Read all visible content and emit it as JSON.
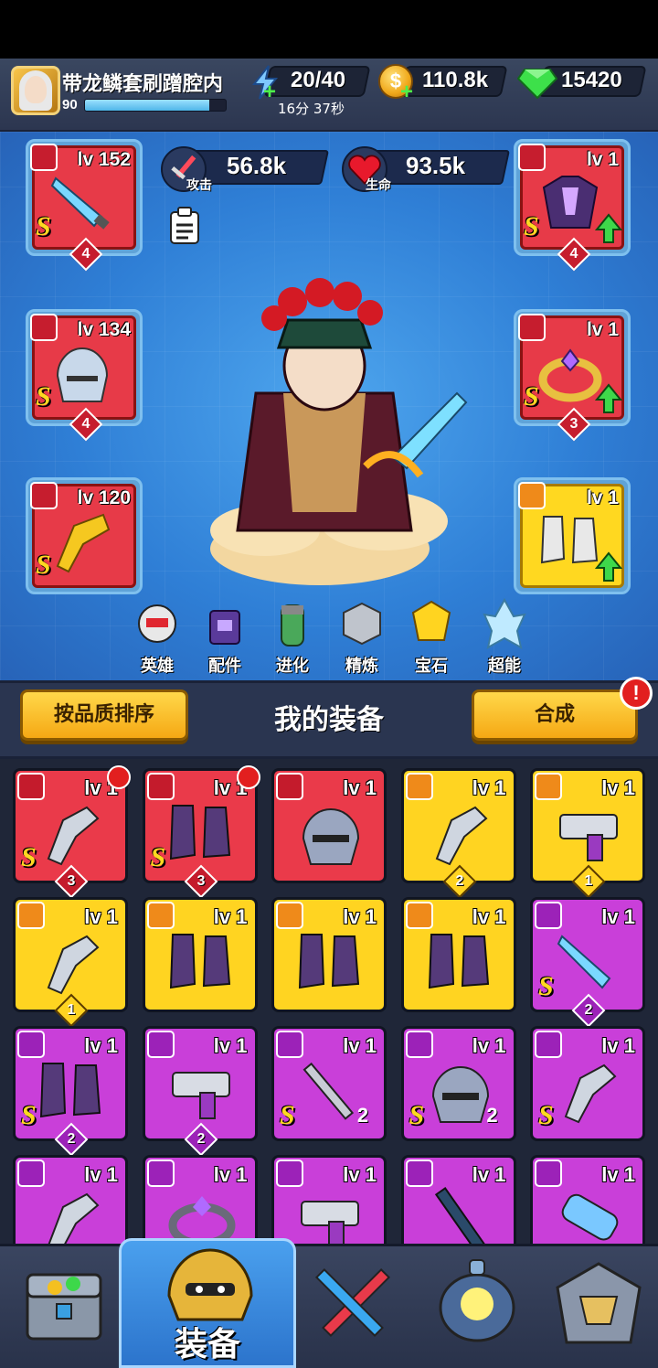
{
  "player": {
    "name": "带龙鳞套刷蹭腔内",
    "level": "90",
    "xp_fraction": 0.88
  },
  "resources": {
    "energy": "20/40",
    "energy_timer": "16分 37秒",
    "coins": "110.8k",
    "gems": "15420"
  },
  "stats": {
    "attack_value": "56.8k",
    "attack_label": "攻击",
    "hp_value": "93.5k",
    "hp_label": "生命"
  },
  "equipped": {
    "weapon": {
      "level": "lv 152",
      "grade": "S",
      "stars": "4"
    },
    "helmet": {
      "level": "lv 134",
      "grade": "S",
      "stars": "4"
    },
    "gloves": {
      "level": "lv 120",
      "grade": "S"
    },
    "armor": {
      "level": "lv 1",
      "grade": "S",
      "stars": "4"
    },
    "ring": {
      "level": "lv 1",
      "grade": "S",
      "stars": "3"
    },
    "boots": {
      "level": "lv 1"
    }
  },
  "hero_menu": [
    {
      "label": "英雄",
      "icon": "hero-icon"
    },
    {
      "label": "配件",
      "icon": "accessory-icon"
    },
    {
      "label": "进化",
      "icon": "evolve-icon"
    },
    {
      "label": "精炼",
      "icon": "refine-icon"
    },
    {
      "label": "宝石",
      "icon": "gem-icon"
    },
    {
      "label": "超能",
      "icon": "superpower-icon"
    }
  ],
  "inventory": {
    "sort_button": "按品质排序",
    "title": "我的装备",
    "merge_button": "合成",
    "alert": "!",
    "items": [
      {
        "level": "lv 1",
        "rarity": "red",
        "grade": "S",
        "count": "3",
        "icon": "gauntlet-icon",
        "new": true
      },
      {
        "level": "lv 1",
        "rarity": "red",
        "grade": "S",
        "count": "3",
        "icon": "boots-icon",
        "new": true
      },
      {
        "level": "lv 1",
        "rarity": "red",
        "grade": "",
        "count": "",
        "icon": "helmet-icon",
        "new": false
      },
      {
        "level": "lv 1",
        "rarity": "gold",
        "grade": "",
        "count": "2",
        "icon": "gauntlet-icon",
        "new": false
      },
      {
        "level": "lv 1",
        "rarity": "gold",
        "grade": "",
        "count": "1",
        "icon": "blaster-icon",
        "new": false
      },
      {
        "level": "lv 1",
        "rarity": "gold",
        "grade": "",
        "count": "1",
        "icon": "gauntlet-icon",
        "new": false
      },
      {
        "level": "lv 1",
        "rarity": "gold",
        "grade": "",
        "count": "",
        "icon": "boots-icon",
        "new": false
      },
      {
        "level": "lv 1",
        "rarity": "gold",
        "grade": "",
        "count": "",
        "icon": "boots-icon",
        "new": false
      },
      {
        "level": "lv 1",
        "rarity": "gold",
        "grade": "",
        "count": "",
        "icon": "boots-icon",
        "new": false
      },
      {
        "level": "lv 1",
        "rarity": "purple",
        "grade": "S",
        "count": "2",
        "icon": "knife-icon",
        "new": false
      },
      {
        "level": "lv 1",
        "rarity": "purple",
        "grade": "S",
        "count": "2",
        "icon": "boots-icon",
        "new": false
      },
      {
        "level": "lv 1",
        "rarity": "purple",
        "grade": "",
        "count": "2",
        "icon": "blaster-icon",
        "new": false
      },
      {
        "level": "lv 1",
        "rarity": "purple",
        "grade": "S",
        "count": "2",
        "icon": "sword-icon",
        "new": false
      },
      {
        "level": "lv 1",
        "rarity": "purple",
        "grade": "S",
        "count": "2",
        "icon": "helmet-icon",
        "new": false
      },
      {
        "level": "lv 1",
        "rarity": "purple",
        "grade": "S",
        "count": "",
        "icon": "gauntlet-icon",
        "new": false
      },
      {
        "level": "lv 1",
        "rarity": "purple",
        "grade": "",
        "count": "",
        "icon": "gauntlet-icon",
        "new": false
      },
      {
        "level": "lv 1",
        "rarity": "purple",
        "grade": "",
        "count": "",
        "icon": "ring-icon",
        "new": false
      },
      {
        "level": "lv 1",
        "rarity": "purple",
        "grade": "",
        "count": "",
        "icon": "blaster-icon",
        "new": false
      },
      {
        "level": "lv 1",
        "rarity": "purple",
        "grade": "",
        "count": "",
        "icon": "rifle-icon",
        "new": false
      },
      {
        "level": "lv 1",
        "rarity": "purple",
        "grade": "",
        "count": "",
        "icon": "cannon-icon",
        "new": false
      }
    ]
  },
  "bottom_nav": {
    "active_label": "装备",
    "tabs": [
      "treasure-chest-icon",
      "equipment-helmet-icon",
      "crossed-swords-icon",
      "portal-icon",
      "trophy-helmet-icon"
    ]
  },
  "colors": {
    "rarity_red": "#ea3a4a",
    "rarity_gold": "#ffd421",
    "rarity_purple": "#c93fd9",
    "accent_yellow": "#ffd84a"
  }
}
